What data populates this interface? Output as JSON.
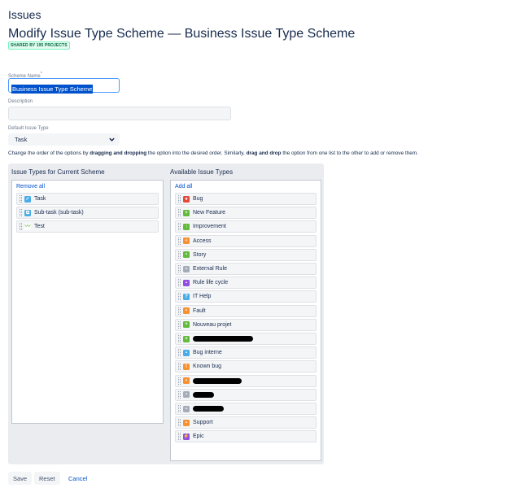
{
  "page": {
    "title": "Issues",
    "scheme_title": "Modify Issue Type Scheme — Business Issue Type Scheme",
    "shared_badge": "SHARED BY 195 PROJECTS"
  },
  "form": {
    "scheme_name_label": "Scheme Name",
    "scheme_name_required": "*",
    "scheme_name_value": "Business Issue Type Scheme",
    "description_label": "Description",
    "description_value": "",
    "default_type_label": "Default Issue Type",
    "default_type_value": "Task"
  },
  "instructions": {
    "part1": "Change the order of the options by ",
    "bold1": "dragging and dropping",
    "part2": " the option into the desired order. Similarly, ",
    "bold2": "drag and drop",
    "part3": " the option from one list to the other to add or remove them."
  },
  "current_scheme": {
    "title": "Issue Types for Current Scheme",
    "remove_all_label": "Remove all",
    "items": [
      {
        "label": "Task",
        "icon": "task-icon",
        "color": "#4bade8",
        "glyph": "✓"
      },
      {
        "label": "Sub-task (sub-task)",
        "icon": "subtask-icon",
        "color": "#4bade8",
        "glyph": "⧉"
      },
      {
        "label": "Test",
        "icon": "test-icon",
        "color": "#ffffff",
        "glyph": "〰"
      }
    ]
  },
  "available": {
    "title": "Available Issue Types",
    "add_all_label": "Add all",
    "items": [
      {
        "label": "Bug",
        "icon": "bug-icon",
        "color": "#e5493a",
        "glyph": "●"
      },
      {
        "label": "New Feature",
        "icon": "new-feature-icon",
        "color": "#63ba3c",
        "glyph": "+"
      },
      {
        "label": "Improvement",
        "icon": "improvement-icon",
        "color": "#63ba3c",
        "glyph": "↑"
      },
      {
        "label": "Access",
        "icon": "access-icon",
        "color": "#f79232",
        "glyph": "▪"
      },
      {
        "label": "Story",
        "icon": "story-icon",
        "color": "#63ba3c",
        "glyph": "▪"
      },
      {
        "label": "External Rule",
        "icon": "external-rule-icon",
        "color": "#a5adba",
        "glyph": "▪"
      },
      {
        "label": "Rule life cycle",
        "icon": "rule-life-cycle-icon",
        "color": "#904ee2",
        "glyph": "▪"
      },
      {
        "label": "IT Help",
        "icon": "it-help-icon",
        "color": "#4bade8",
        "glyph": "?"
      },
      {
        "label": "Fault",
        "icon": "fault-icon",
        "color": "#f79232",
        "glyph": "▪"
      },
      {
        "label": "Nouveau projet",
        "icon": "nouveau-projet-icon",
        "color": "#63ba3c",
        "glyph": "+"
      },
      {
        "label": "",
        "icon": "redacted-icon",
        "color": "#63ba3c",
        "glyph": "+",
        "redacted": true,
        "redact_w": 74
      },
      {
        "label": "Bug interne",
        "icon": "bug-interne-icon",
        "color": "#4bade8",
        "glyph": "▪"
      },
      {
        "label": "Known bug",
        "icon": "known-bug-icon",
        "color": "#f79232",
        "glyph": "!"
      },
      {
        "label": "",
        "icon": "redacted-icon",
        "color": "#f79232",
        "glyph": "▪",
        "redacted": true,
        "redact_w": 60
      },
      {
        "label": "",
        "icon": "redacted-icon",
        "color": "#a5adba",
        "glyph": "▪",
        "redacted": true,
        "redact_w": 26
      },
      {
        "label": "",
        "icon": "redacted-icon",
        "color": "#a5adba",
        "glyph": "▪",
        "redacted": true,
        "redact_w": 38
      },
      {
        "label": "Support",
        "icon": "support-icon",
        "color": "#f79232",
        "glyph": "▪"
      },
      {
        "label": "Epic",
        "icon": "epic-icon",
        "color": "#904ee2",
        "glyph": "⚡"
      }
    ]
  },
  "buttons": {
    "save": "Save",
    "reset": "Reset",
    "cancel": "Cancel"
  }
}
